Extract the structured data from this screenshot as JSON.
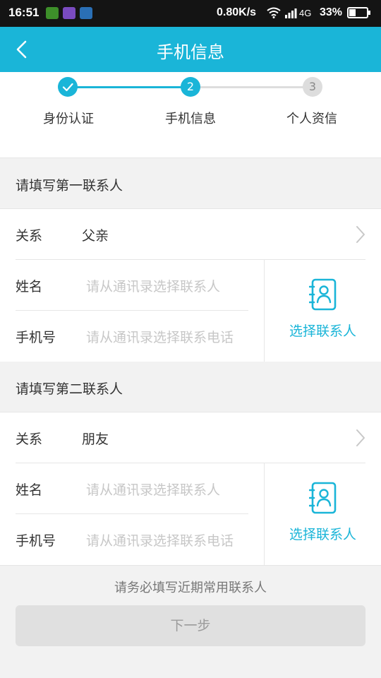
{
  "status_bar": {
    "time": "16:51",
    "speed": "0.80K/s",
    "network": "4G",
    "battery": "33%"
  },
  "header": {
    "title": "手机信息"
  },
  "stepper": {
    "steps": [
      {
        "number": "1",
        "label": "身份认证",
        "state": "done"
      },
      {
        "number": "2",
        "label": "手机信息",
        "state": "current"
      },
      {
        "number": "3",
        "label": "个人资信",
        "state": "pending"
      }
    ]
  },
  "contacts": [
    {
      "section_title": "请填写第一联系人",
      "relation_label": "关系",
      "relation_value": "父亲",
      "name_label": "姓名",
      "name_placeholder": "请从通讯录选择联系人",
      "phone_label": "手机号",
      "phone_placeholder": "请从通讯录选择联系电话",
      "picker_label": "选择联系人"
    },
    {
      "section_title": "请填写第二联系人",
      "relation_label": "关系",
      "relation_value": "朋友",
      "name_label": "姓名",
      "name_placeholder": "请从通讯录选择联系人",
      "phone_label": "手机号",
      "phone_placeholder": "请从通讯录选择联系电话",
      "picker_label": "选择联系人"
    }
  ],
  "footer": {
    "notice": "请务必填写近期常用联系人",
    "next_label": "下一步"
  },
  "colors": {
    "accent": "#1ab5d8",
    "status_bar": "#141414",
    "step_pending": "#dddddd",
    "button_disabled": "#e0e0e0"
  },
  "icons": {
    "back": "chevron-left-icon",
    "chevron": "chevron-right-icon",
    "contact_book": "contact-book-icon",
    "step_done": "check-icon"
  }
}
